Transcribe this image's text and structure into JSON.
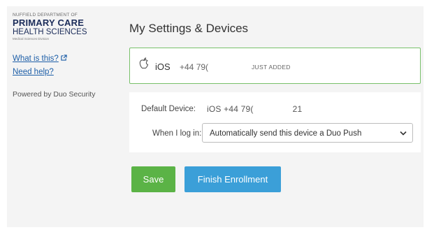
{
  "sidebar": {
    "logo": {
      "line1": "NUFFIELD DEPARTMENT OF",
      "line2": "PRIMARY CARE",
      "line3": "HEALTH SCIENCES",
      "line4": "Medical Sciences Division"
    },
    "what_is_this": "What is this?",
    "need_help": "Need help?",
    "powered_by": "Powered by Duo Security"
  },
  "main": {
    "title": "My Settings & Devices",
    "device": {
      "icon": "apple-icon",
      "name": "iOS",
      "phone": "+44 79(",
      "status": "JUST ADDED"
    },
    "settings": {
      "default_label": "Default Device:",
      "default_value_prefix": "iOS +44 79(",
      "default_value_suffix": "21",
      "login_label": "When I log in:",
      "login_option": "Automatically send this device a Duo Push"
    },
    "buttons": {
      "save": "Save",
      "finish": "Finish Enrollment"
    }
  },
  "colors": {
    "accent_green": "#5bb346",
    "accent_blue": "#3b9fd8",
    "card_border": "#78c06a",
    "link": "#1e5fa8"
  }
}
